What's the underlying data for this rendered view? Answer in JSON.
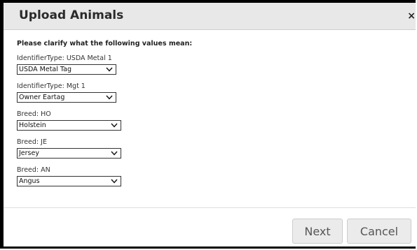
{
  "dialog": {
    "title": "Upload Animals",
    "close_label": "×"
  },
  "prompt": "Please clarify what the following values mean:",
  "fields": [
    {
      "label": "IdentifierType: USDA Metal 1",
      "selected": "USDA Metal Tag"
    },
    {
      "label": "IdentifierType: Mgt 1",
      "selected": "Owner Eartag"
    },
    {
      "label": "Breed: HO",
      "selected": "Holstein"
    },
    {
      "label": "Breed: JE",
      "selected": "Jersey"
    },
    {
      "label": "Breed: AN",
      "selected": "Angus"
    }
  ],
  "buttons": {
    "next_label": "Next",
    "cancel_label": "Cancel"
  },
  "icons": {
    "dropdown": "chevron-down-icon",
    "close": "close-icon"
  }
}
